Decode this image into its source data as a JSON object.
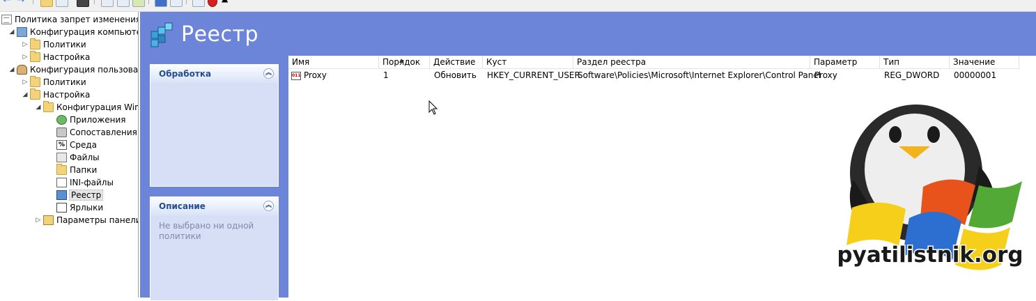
{
  "tree": {
    "root": "Политика запрет изменения п",
    "items": [
      {
        "label": "Конфигурация компьютер",
        "icon": "computer-config-icon"
      },
      {
        "label": "Политики",
        "icon": "folder-icon"
      },
      {
        "label": "Настройка",
        "icon": "folder-icon"
      },
      {
        "label": "Конфигурация пользовате",
        "icon": "user-config-icon"
      },
      {
        "label": "Политики",
        "icon": "folder-icon"
      },
      {
        "label": "Настройка",
        "icon": "folder-icon"
      },
      {
        "label": "Конфигурация Winc",
        "icon": "folder-icon"
      },
      {
        "label": "Приложения",
        "icon": "applications-icon"
      },
      {
        "label": "Сопоставления ,",
        "icon": "drive-maps-icon"
      },
      {
        "label": "Среда",
        "icon": "environment-icon"
      },
      {
        "label": "Файлы",
        "icon": "files-icon"
      },
      {
        "label": "Папки",
        "icon": "folders-icon"
      },
      {
        "label": "INI-файлы",
        "icon": "ini-files-icon"
      },
      {
        "label": "Реестр",
        "icon": "registry-icon"
      },
      {
        "label": "Ярлыки",
        "icon": "shortcuts-icon"
      },
      {
        "label": "Параметры панели",
        "icon": "control-panel-icon"
      }
    ]
  },
  "header": {
    "title": "Реестр"
  },
  "tasks": {
    "processing": {
      "title": "Обработка"
    },
    "description": {
      "title": "Описание",
      "text_line1": "Не выбрано ни одной",
      "text_line2": "политики"
    }
  },
  "list": {
    "columns": [
      "Имя",
      "Порядок",
      "Действие",
      "Куст",
      "Раздел реестра",
      "Параметр",
      "Тип",
      "Значение"
    ],
    "rows": [
      {
        "name": "Proxy",
        "order": "1",
        "action": "Обновить",
        "hive": "HKEY_CURRENT_USER",
        "key": "Software\\Policies\\Microsoft\\Internet Explorer\\Control Panel",
        "param": "Proxy",
        "type": "REG_DWORD",
        "value": "00000001"
      }
    ]
  },
  "watermark": {
    "text": "pyatilistnik.org"
  },
  "colors": {
    "header_bg": "#6c85d8",
    "task_bg": "#d6dff5",
    "task_title": "#254c93"
  }
}
